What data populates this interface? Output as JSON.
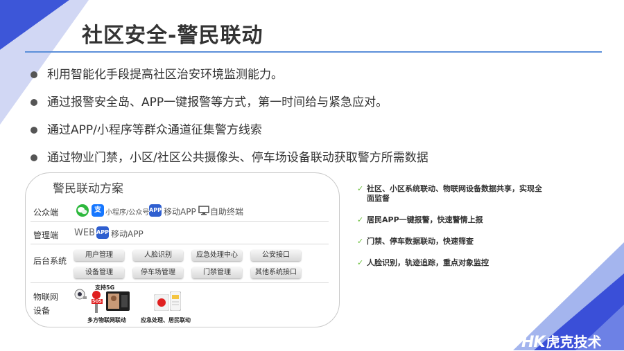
{
  "title": "社区安全-警民联动",
  "bullets": [
    "利用智能化手段提高社区治安环境监测能力。",
    "通过报警安全岛、APP一键报警等方式，第一时间给与紧急应对。",
    "通过APP/小程序等群众通道征集警方线索",
    "通过物业门禁，小区/社区公共摄像头、停车场设备联动获取警方所需数据"
  ],
  "panel": {
    "title": "警民联动方案",
    "rows": {
      "public": {
        "label": "公众端",
        "wechat_icon": "wechat-icon",
        "alipay_icon": "支",
        "mini_program": "小程序/公众号",
        "app_badge": "APP",
        "mobile_app": "移动APP",
        "terminal": "自助终端"
      },
      "manage": {
        "label": "管理端",
        "web": "WEB",
        "app_badge": "APP",
        "mobile_app": "移动APP"
      },
      "backend": {
        "label": "后台系统",
        "modules": [
          "用户管理",
          "人脸识别",
          "应急处理中心",
          "公安接口",
          "设备管理",
          "停车场管理",
          "门禁管理",
          "其他系统接口"
        ]
      },
      "iot": {
        "label_line1": "物联网",
        "label_line2": "设备",
        "badge_5g": "支持5G",
        "sos": "SOS",
        "caption_left": "多方物联网联动",
        "caption_right": "应急处理、居民联动"
      }
    }
  },
  "features": [
    "社区、小区系统联动、物联网设备数据共享，实现全面监督",
    "居民APP一键报警，快速警情上报",
    "门禁、停车数据联动，快速筛查",
    "人脸识别，轨迹追踪，重点对象监控"
  ],
  "brand": {
    "mark": "HK",
    "name": "虎克技术"
  },
  "colors": {
    "accent_blue": "#3a4fd8",
    "rule_blue": "#5b8fd9",
    "check_green": "#6abf3a",
    "wechat_green": "#2db83d",
    "alipay_blue": "#1677ff",
    "app_blue": "#2f5fd0"
  }
}
